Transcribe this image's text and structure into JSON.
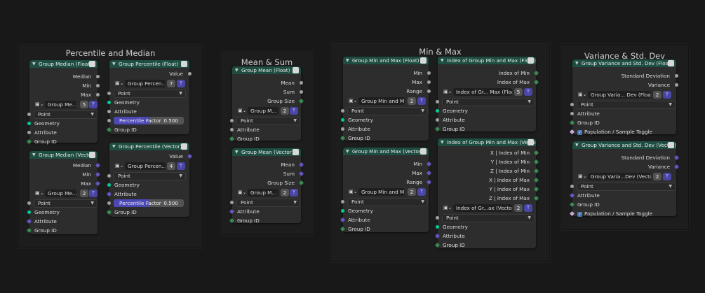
{
  "frames": {
    "percentile": "Percentile and Median",
    "meansum": "Mean & Sum",
    "minmax": "Min & Max",
    "variance": "Variance & Std. Dev"
  },
  "common": {
    "domain_point": "Point",
    "geometry": "Geometry",
    "attribute": "Attribute",
    "group_id": "Group ID"
  },
  "nodes": {
    "median_float": {
      "title": "Group Median (Float)",
      "outs": [
        "Median",
        "Min",
        "Max"
      ],
      "id_name": "Group Me...",
      "id_num": "5"
    },
    "median_vector": {
      "title": "Group Median (Vector)",
      "outs": [
        "Median",
        "Min",
        "Max"
      ],
      "id_name": "Group Me...",
      "id_num": "2"
    },
    "percentile_float": {
      "title": "Group Percentile (Float)",
      "outs": [
        "Value"
      ],
      "id_name": "Group Percen...",
      "id_num": "7",
      "factor_label": "Percentile Factor",
      "factor_value": "0.500",
      "factor_fraction": 0.5
    },
    "percentile_vector": {
      "title": "Group Percentile (Vector)",
      "outs": [
        "Value"
      ],
      "id_name": "Group Percen...",
      "id_num": "4",
      "factor_label": "Percentile Factor",
      "factor_value": "0.500",
      "factor_fraction": 0.5
    },
    "mean_float": {
      "title": "Group Mean (Float)",
      "outs": [
        "Mean",
        "Sum",
        "Group Size"
      ],
      "id_name": "Group M...",
      "id_num": "2"
    },
    "mean_vector": {
      "title": "Group Mean (Vector)",
      "outs": [
        "Mean",
        "Sum",
        "Group Size"
      ],
      "id_name": "Group M...",
      "id_num": "2"
    },
    "minmax_float": {
      "title": "Group Min and Max (Float)",
      "outs": [
        "Min",
        "Max",
        "Range"
      ],
      "id_name": "Group Min and M...",
      "id_num": "2"
    },
    "minmax_vector": {
      "title": "Group Min and Max (Vector)",
      "outs": [
        "Min",
        "Max",
        "Range"
      ],
      "id_name": "Group Min and M...",
      "id_num": "2"
    },
    "index_float": {
      "title": "Index of Group Min and Max (Float)",
      "outs": [
        "Index of Min",
        "Index of Max"
      ],
      "id_name": "Index of Gr... Max (Float)",
      "id_num": "5"
    },
    "index_vector": {
      "title": "Index of Group Min and Max (Vector)",
      "outs": [
        "X | Index of Min",
        "Y | Index of Min",
        "Z | Index of Min",
        "X | Index of Max",
        "Y | Index of Max",
        "Z | Index of Max"
      ],
      "id_name": "Index of Gr...ax (Vector)",
      "id_num": "2"
    },
    "variance_float": {
      "title": "Group Variance and Std. Dev (Float)",
      "outs": [
        "Standard Deviation",
        "Variance"
      ],
      "id_name": "Group Varia... Dev (Float)",
      "id_num": "2",
      "toggle": "Population / Sample Toggle"
    },
    "variance_vector": {
      "title": "Group Variance and Std. Dev (Vector)",
      "outs": [
        "Standard Deviation",
        "Variance"
      ],
      "id_name": "Group Varia...Dev (Vector)",
      "id_num": "2",
      "toggle": "Population / Sample Toggle"
    }
  },
  "colors": {
    "header": "#1e4d41",
    "socket_float": "#a1a1a1",
    "socket_int": "#3a8a4e",
    "socket_vector": "#6455c4",
    "socket_geometry": "#00cc96",
    "accent": "#4c48b5"
  }
}
